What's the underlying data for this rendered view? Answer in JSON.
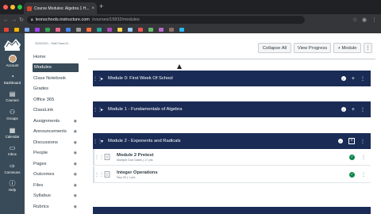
{
  "browser": {
    "tab_title": "Course Modules: Algebra 1 H...",
    "tab_close": "×",
    "new_tab": "+",
    "url_host": "leonschools.instructure.com",
    "url_path": "/courses/15832/modules",
    "bookmark_colors": [
      "#e8453c",
      "#f4b400",
      "#7baaf7",
      "#a142f4",
      "#34a853",
      "#f06292",
      "#4285f4",
      "#9e9e9e",
      "#ff7043",
      "#26a69a",
      "#ab47bc",
      "#ffd54f",
      "#90caf9",
      "#ef5350",
      "#66bb6a",
      "#ba68c8",
      "#8d6e63",
      "#29b6f6"
    ]
  },
  "global_nav": {
    "items": [
      {
        "label": "Account",
        "icon": "user-avatar-icon"
      },
      {
        "label": "Dashboard",
        "icon": "dashboard-icon"
      },
      {
        "label": "Courses",
        "icon": "book-icon"
      },
      {
        "label": "Groups",
        "icon": "groups-icon"
      },
      {
        "label": "Calendar",
        "icon": "calendar-icon"
      },
      {
        "label": "Inbox",
        "icon": "inbox-icon"
      },
      {
        "label": "Commons",
        "icon": "commons-icon"
      },
      {
        "label": "Help",
        "icon": "help-icon"
      }
    ]
  },
  "course_nav": {
    "term": "2020/2021 - Staff Class M...",
    "items": [
      {
        "label": "Home",
        "hidden": false
      },
      {
        "label": "Modules",
        "hidden": false,
        "active": true
      },
      {
        "label": "Class Notebook",
        "hidden": false
      },
      {
        "label": "Grades",
        "hidden": false
      },
      {
        "label": "Office 365",
        "hidden": false
      },
      {
        "label": "ClassLink",
        "hidden": false
      },
      {
        "label": "Assignments",
        "hidden": true
      },
      {
        "label": "Announcements",
        "hidden": true
      },
      {
        "label": "Discussions",
        "hidden": true
      },
      {
        "label": "People",
        "hidden": true
      },
      {
        "label": "Pages",
        "hidden": true
      },
      {
        "label": "Outcomes",
        "hidden": true
      },
      {
        "label": "Files",
        "hidden": true
      },
      {
        "label": "Syllabus",
        "hidden": true
      },
      {
        "label": "Rubrics",
        "hidden": true
      }
    ]
  },
  "toolbar": {
    "collapse_all": "Collapse All",
    "view_progress": "View Progress",
    "add_module": "+ Module"
  },
  "modules": [
    {
      "title": "Module 0: First Week Of School",
      "expanded": false
    },
    {
      "title": "Module 1 - Fundamentals of Algebra",
      "expanded": false
    },
    {
      "title": "Module 2 - Exponents and Radicals",
      "expanded": true,
      "items": [
        {
          "name": "Module 2 Pretest",
          "meta": "Multiple Due Dates | 17 pts"
        },
        {
          "name": "Integer Operations",
          "meta": "Sep 29 | 1 pts"
        }
      ]
    }
  ],
  "colors": {
    "nav_bg": "#394b58",
    "module_header": "#1a2b55",
    "complete_green": "#0b874b"
  }
}
